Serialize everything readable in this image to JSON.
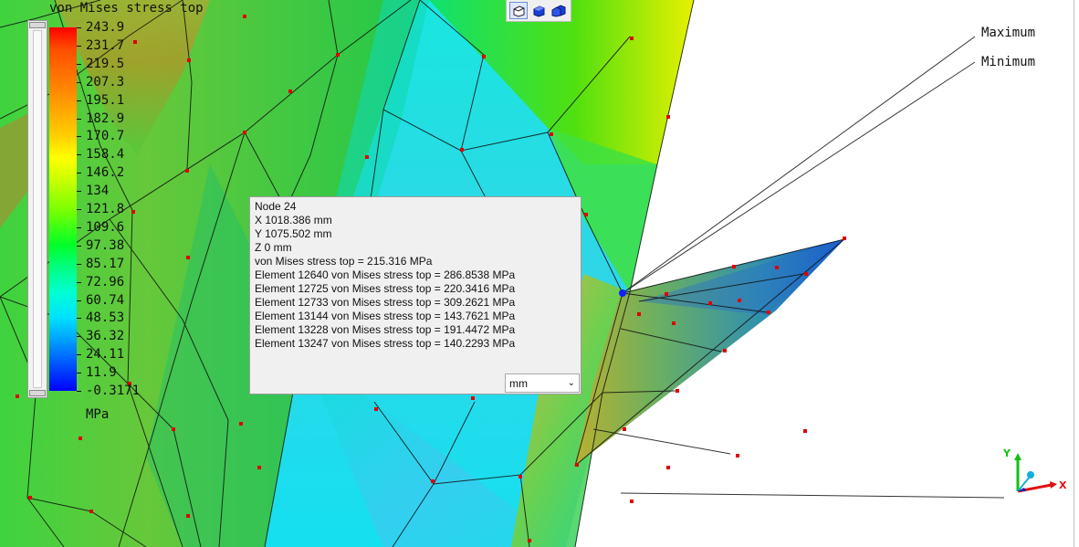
{
  "legend": {
    "title": "von Mises stress top",
    "labels": [
      "243.9",
      "231.7",
      "219.5",
      "207.3",
      "195.1",
      "182.9",
      "170.7",
      "158.4",
      "146.2",
      "134",
      "121.8",
      "109.6",
      "97.38",
      "85.17",
      "72.96",
      "60.74",
      "48.53",
      "36.32",
      "24.11",
      "11.9",
      "-0.3171"
    ],
    "unit": "MPa"
  },
  "callouts": {
    "maximum": "Maximum",
    "minimum": "Minimum"
  },
  "view_toolbar": {
    "buttons": [
      "view-cube-outline-icon",
      "view-cube-solid-icon",
      "view-cube-multi-icon"
    ]
  },
  "info": {
    "lines": [
      "Node  24",
      "X  1018.386 mm",
      "Y  1075.502 mm",
      "Z  0 mm",
      "von Mises stress top = 215.316 MPa",
      "Element 12640 von Mises stress top = 286.8538 MPa",
      "Element 12725 von Mises stress top = 220.3416 MPa",
      "Element 12733 von Mises stress top = 309.2621 MPa",
      "Element 13144 von Mises stress top = 143.7621 MPa",
      "Element 13228 von Mises stress top = 191.4472 MPa",
      "Element 13247 von Mises stress top = 140.2293 MPa"
    ],
    "unit_select": "mm"
  },
  "axes": {
    "x": "X",
    "y": "Y"
  },
  "colors": {
    "x_axis": "#e01010",
    "y_axis": "#10c010",
    "z_axis": "#10b0e0",
    "selected_node": "#1020ff",
    "mesh_node": "#e00000"
  }
}
